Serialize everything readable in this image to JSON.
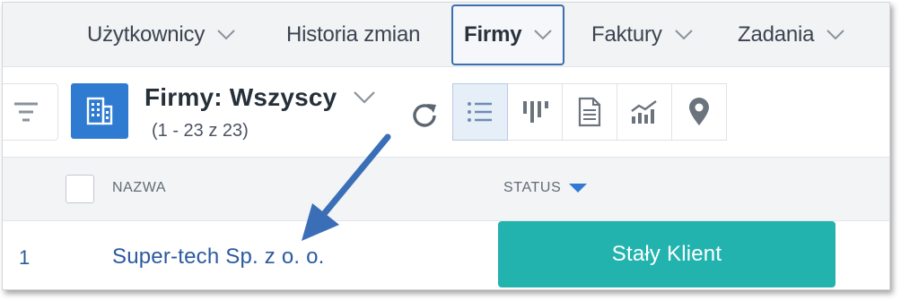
{
  "nav": {
    "items": [
      {
        "label": "Użytkownicy",
        "has_dropdown": true
      },
      {
        "label": "Historia zmian",
        "has_dropdown": false
      },
      {
        "label": "Firmy",
        "has_dropdown": true,
        "active": true
      },
      {
        "label": "Faktury",
        "has_dropdown": true
      },
      {
        "label": "Zadania",
        "has_dropdown": true
      }
    ]
  },
  "toolbar": {
    "title": "Firmy: Wszyscy",
    "count": "(1 - 23 z 23)",
    "icons": [
      "filter-icon",
      "building-icon",
      "chevron-down-icon",
      "refresh-icon",
      "list-view-icon",
      "pipeline-icon",
      "document-icon",
      "chart-icon",
      "map-pin-icon"
    ]
  },
  "table": {
    "columns": [
      "NAZWA",
      "STATUS"
    ],
    "rows": [
      {
        "number": "1",
        "name": "Super-tech Sp. z o. o.",
        "status": "Stały Klient"
      }
    ]
  },
  "colors": {
    "accent": "#2f7bd2",
    "status_badge": "#22b3ae",
    "link": "#2c5aa0",
    "annotation_arrow": "#3a6fb8"
  }
}
